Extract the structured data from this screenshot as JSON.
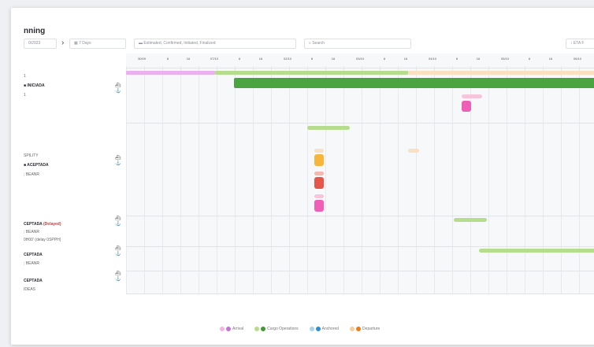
{
  "page": {
    "title": "nning"
  },
  "toolbar": {
    "date_value": "0/2023",
    "period_label": "7 Days",
    "status_filter": "Estimated, Confirmed, Initiated, Finalized",
    "search_placeholder": "Search",
    "sort_label": "ETA F"
  },
  "timeline": {
    "ticks": [
      {
        "label": "30/09"
      },
      {
        "label": "8"
      },
      {
        "label": "16"
      },
      {
        "label": "07/10"
      },
      {
        "label": "8"
      },
      {
        "label": "16"
      },
      {
        "label": "02/10"
      },
      {
        "label": "8"
      },
      {
        "label": "16"
      },
      {
        "label": "03/10"
      },
      {
        "label": "8"
      },
      {
        "label": "16"
      },
      {
        "label": "04/10"
      },
      {
        "label": "8"
      },
      {
        "label": "16"
      },
      {
        "label": "05/10"
      },
      {
        "label": "8"
      },
      {
        "label": "16"
      },
      {
        "label": "06/10"
      }
    ]
  },
  "rows": [
    {
      "line1": "1",
      "line2": "INICIADA",
      "line3": "1",
      "delayed": ""
    },
    {
      "line1": "SPILITY",
      "line2": "ACEPTADA",
      "line3": "; BEANR",
      "delayed": ""
    },
    {
      "line1": "CEPTADA",
      "delayed": "(Delayed)",
      "line2": "; BEANR",
      "line3": "0H00' (delay 0SPPH)"
    },
    {
      "line1": "CEPTADA",
      "line2": "; BEANR",
      "line3": "",
      "delayed": ""
    },
    {
      "line1": "CEPTADA",
      "line2": "IDEAS",
      "line3": "",
      "delayed": ""
    }
  ],
  "legend": [
    {
      "label": "Arrival",
      "colors": [
        "#f4b6e0",
        "#c86fd8"
      ]
    },
    {
      "label": "Cargo Operations",
      "colors": [
        "#b8dc8e",
        "#3f9b3a"
      ]
    },
    {
      "label": "Anchored",
      "colors": [
        "#a8d4f2",
        "#2f8fd6"
      ]
    },
    {
      "label": "Departure",
      "colors": [
        "#f7cf9a",
        "#f07a1b"
      ]
    }
  ],
  "colors": {
    "arrival_light": "#ebb0ee",
    "cargo_light": "#b6dc8d",
    "cargo_dark": "#4aa43f",
    "departure_light": "#f8e0c0",
    "pink": "#ef5fb5",
    "orange": "#f6b63b",
    "red": "#e4574a"
  }
}
